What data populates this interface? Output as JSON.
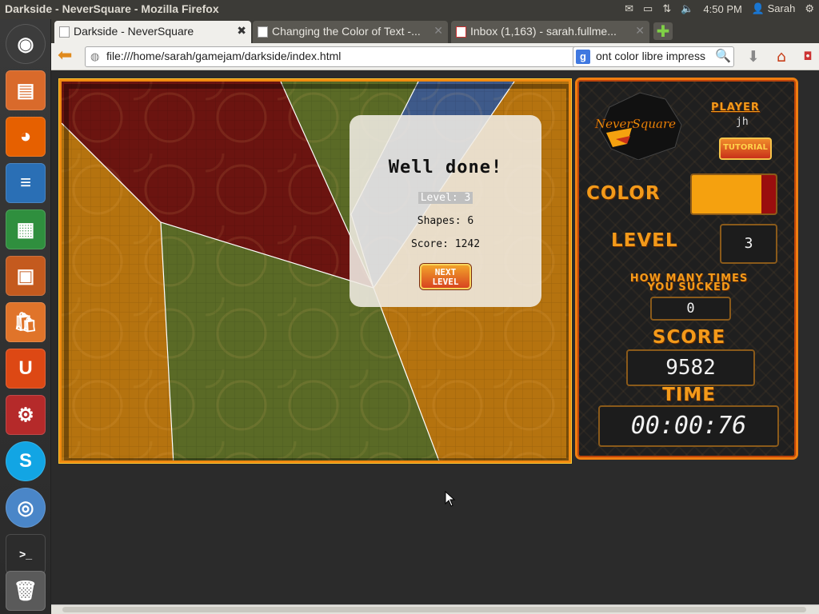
{
  "top_panel": {
    "window_title": "Darkside - NeverSquare - Mozilla Firefox",
    "time": "4:50 PM",
    "user": "Sarah"
  },
  "launcher": {
    "items": [
      {
        "name": "dash-home-icon",
        "color": "#3c3c3c"
      },
      {
        "name": "files-icon",
        "color": "#d96a2b"
      },
      {
        "name": "firefox-icon",
        "color": "#e66000"
      },
      {
        "name": "writer-icon",
        "color": "#2a6fb5"
      },
      {
        "name": "calc-icon",
        "color": "#2f8f3e"
      },
      {
        "name": "impress-icon",
        "color": "#c45a1e"
      },
      {
        "name": "software-center-icon",
        "color": "#e0742a"
      },
      {
        "name": "ubuntu-one-icon",
        "color": "#dd4814"
      },
      {
        "name": "system-settings-icon",
        "color": "#b52a2a"
      },
      {
        "name": "skype-icon",
        "color": "#12a5e4"
      },
      {
        "name": "chromium-icon",
        "color": "#4a86c8"
      },
      {
        "name": "terminal-icon",
        "color": "#2c2c2c"
      },
      {
        "name": "trash-icon",
        "color": "#5a5a5a"
      }
    ]
  },
  "tabs": [
    {
      "label": "Darkside - NeverSquare",
      "active": true
    },
    {
      "label": "Changing the Color of Text -...",
      "active": false
    },
    {
      "label": "Inbox (1,163) - sarah.fullme...",
      "active": false
    }
  ],
  "navbar": {
    "url": "file:///home/sarah/gamejam/darkside/index.html",
    "search_text": "ont color libre impress"
  },
  "dialog": {
    "title": "Well done!",
    "level_text": "Level: 3",
    "shapes_text": "Shapes: 6",
    "score_text": "Score: 1242",
    "next_button_line1": "NEXT",
    "next_button_line2": "LEVEL"
  },
  "panel": {
    "logo_text": "NeverSquare",
    "player_label": "PLAYER",
    "player_name": "jh",
    "tutorial_label": "TUTORIAL",
    "color_label": "COLOR",
    "level_label": "LEVEL",
    "level_value": "3",
    "sucked_label_line1": "HOW MANY TIMES",
    "sucked_label_line2": "YOU SUCKED",
    "sucked_value": "0",
    "score_label": "SCORE",
    "score_value": "9582",
    "time_label": "TIME",
    "time_value": "00:00:76",
    "colors": {
      "primary": "#f5a10f",
      "secondary": "#9a0e0e"
    }
  },
  "board_colors": {
    "dark_red": "#6b1410",
    "olive": "#5a6a26",
    "amber": "#b5730f",
    "blue": "#3e5a8a",
    "orange_bright": "#c7801a"
  }
}
